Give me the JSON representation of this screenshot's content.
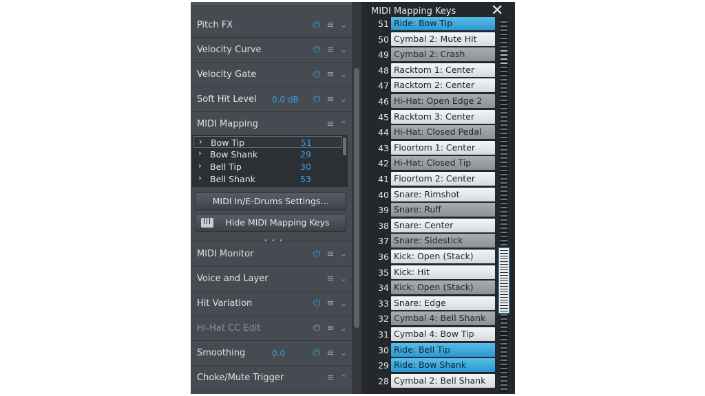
{
  "left_panel": {
    "rows": [
      {
        "label": "Pitch FX",
        "value": "",
        "power": true,
        "dim": false
      },
      {
        "label": "Velocity Curve",
        "value": "",
        "power": true,
        "dim": false
      },
      {
        "label": "Velocity Gate",
        "value": "",
        "power": true,
        "dim": false
      },
      {
        "label": "Soft Hit Level",
        "value": "0.0 dB",
        "power": true,
        "dim": false
      }
    ],
    "midi_mapping": {
      "label": "MIDI Mapping",
      "items": [
        {
          "name": "Bow Tip",
          "value": "51"
        },
        {
          "name": "Bow Shank",
          "value": "29"
        },
        {
          "name": "Bell Tip",
          "value": "30"
        },
        {
          "name": "Bell Shank",
          "value": "53"
        }
      ],
      "settings_button": "MIDI In/E-Drums Settings...",
      "hide_keys_button": "Hide MIDI Mapping Keys",
      "grip": "• • •"
    },
    "rows_bottom": [
      {
        "label": "MIDI Monitor",
        "value": "",
        "power": true,
        "dim": false
      },
      {
        "label": "Voice and Layer",
        "value": "",
        "power": false,
        "dim": false
      },
      {
        "label": "Hit Variation",
        "value": "",
        "power": true,
        "dim": false
      },
      {
        "label": "Hi-Hat CC Edit",
        "value": "",
        "power": true,
        "dim": true
      },
      {
        "label": "Smoothing",
        "value": "0.0",
        "power": true,
        "dim": false
      },
      {
        "label": "Choke/Mute Trigger",
        "value": "",
        "power": false,
        "dim": false
      }
    ]
  },
  "right_panel": {
    "title": "MIDI Mapping Keys",
    "close": "✕",
    "keys": [
      {
        "num": "51",
        "label": "Ride: Bow Tip",
        "style": "b"
      },
      {
        "num": "50",
        "label": "Cymbal 2: Mute Hit",
        "style": "w"
      },
      {
        "num": "49",
        "label": "Cymbal 2: Crash",
        "style": "g"
      },
      {
        "num": "48",
        "label": "Racktom 1: Center",
        "style": "w"
      },
      {
        "num": "47",
        "label": "Racktom 2: Center",
        "style": "w"
      },
      {
        "num": "46",
        "label": "Hi-Hat: Open Edge 2",
        "style": "g"
      },
      {
        "num": "45",
        "label": "Racktom 3: Center",
        "style": "w"
      },
      {
        "num": "44",
        "label": "Hi-Hat: Closed Pedal",
        "style": "g"
      },
      {
        "num": "43",
        "label": "Floortom 1: Center",
        "style": "w"
      },
      {
        "num": "42",
        "label": "Hi-Hat: Closed Tip",
        "style": "g"
      },
      {
        "num": "41",
        "label": "Floortom 2: Center",
        "style": "w"
      },
      {
        "num": "40",
        "label": "Snare: Rimshot",
        "style": "w"
      },
      {
        "num": "39",
        "label": "Snare: Ruff",
        "style": "g"
      },
      {
        "num": "38",
        "label": "Snare: Center",
        "style": "w"
      },
      {
        "num": "37",
        "label": "Snare: Sidestick",
        "style": "g"
      },
      {
        "num": "36",
        "label": "Kick: Open (Stack)",
        "style": "w"
      },
      {
        "num": "35",
        "label": "Kick: Hit",
        "style": "w"
      },
      {
        "num": "34",
        "label": "Kick: Open (Stack)",
        "style": "g"
      },
      {
        "num": "33",
        "label": "Snare: Edge",
        "style": "w"
      },
      {
        "num": "32",
        "label": "Cymbal 4: Bell Shank",
        "style": "g"
      },
      {
        "num": "31",
        "label": "Cymbal 4: Bow Tip",
        "style": "w"
      },
      {
        "num": "30",
        "label": "Ride: Bell Tip",
        "style": "b"
      },
      {
        "num": "29",
        "label": "Ride: Bow Shank",
        "style": "b"
      },
      {
        "num": "28",
        "label": "Cymbal 2: Bell Shank",
        "style": "w"
      }
    ]
  },
  "icons": {
    "power": "⏻",
    "menu": "≡",
    "expand": "⌄",
    "collapse": "⌃",
    "chevron": "›"
  },
  "colors": {
    "accent": "#3aa2e0",
    "panel": "#464b52",
    "dark": "#24282c"
  }
}
